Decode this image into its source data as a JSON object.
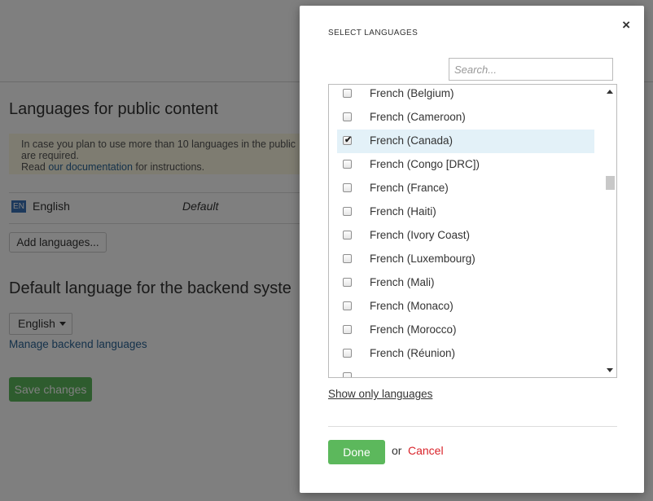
{
  "background": {
    "public_content_heading": "Languages for public content",
    "notice": {
      "line1": "In case you plan to use more than 10 languages in the public",
      "line2": "are required.",
      "line3_prefix": "Read ",
      "link": "our documentation",
      "line3_suffix": " for instructions."
    },
    "language_row": {
      "badge": "EN",
      "name": "English",
      "status": "Default"
    },
    "add_languages_label": "Add languages...",
    "backend_heading": "Default language for the backend syste",
    "backend_select_value": "English",
    "manage_backend_link": "Manage backend languages",
    "save_changes_label": "Save changes"
  },
  "modal": {
    "title": "SELECT LANGUAGES",
    "close_glyph": "×",
    "search_placeholder": "Search...",
    "items": [
      {
        "label": "French (Belgium)",
        "checked": false
      },
      {
        "label": "French (Cameroon)",
        "checked": false
      },
      {
        "label": "French (Canada)",
        "checked": true
      },
      {
        "label": "French (Congo [DRC])",
        "checked": false
      },
      {
        "label": "French (France)",
        "checked": false
      },
      {
        "label": "French (Haiti)",
        "checked": false
      },
      {
        "label": "French (Ivory Coast)",
        "checked": false
      },
      {
        "label": "French (Luxembourg)",
        "checked": false
      },
      {
        "label": "French (Mali)",
        "checked": false
      },
      {
        "label": "French (Monaco)",
        "checked": false
      },
      {
        "label": "French (Morocco)",
        "checked": false
      },
      {
        "label": "French (Réunion)",
        "checked": false
      }
    ],
    "show_only_label": "Show only languages",
    "done_label": "Done",
    "or_label": "or",
    "cancel_label": "Cancel"
  },
  "colors": {
    "primary_green": "#5cb85c",
    "cancel_red": "#d9232a",
    "selected_row": "#e3f1f8",
    "link_blue": "#2a6496"
  }
}
